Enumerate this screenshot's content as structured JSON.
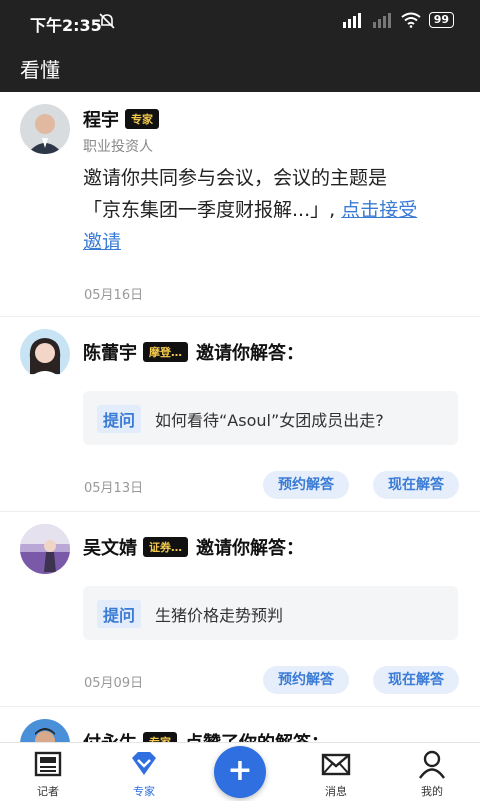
{
  "status_bar": {
    "time": "下午2:35",
    "battery": "99"
  },
  "header": {
    "title": "看懂"
  },
  "feed": [
    {
      "name": "程宇",
      "badge": "专家",
      "role": "职业投资人",
      "msg_prefix": "邀请你共同参与会议，会议的主题是「京东集团一季度财报解...」, ",
      "msg_link": "点击接受邀请",
      "date": "05月16日"
    },
    {
      "name": "陈蕾宇",
      "badge": "摩登…",
      "action": "邀请你解答：",
      "q_tag": "提问",
      "question": "如何看待“Asoul”女团成员出走?",
      "date": "05月13日",
      "btn_schedule": "预约解答",
      "btn_now": "现在解答"
    },
    {
      "name": "吴文婧",
      "badge": "证券…",
      "action": "邀请你解答：",
      "q_tag": "提问",
      "question": "生猪价格走势预判",
      "date": "05月09日",
      "btn_schedule": "预约解答",
      "btn_now": "现在解答"
    },
    {
      "name": "付永生",
      "badge": "专家",
      "action": "点赞了你的解答："
    }
  ],
  "tabbar": {
    "tabs": [
      {
        "label": "记者",
        "icon": "newspaper-icon"
      },
      {
        "label": "专家",
        "icon": "diamond-icon"
      },
      {
        "label": "",
        "icon": "plus-icon"
      },
      {
        "label": "消息",
        "icon": "mail-icon"
      },
      {
        "label": "我的",
        "icon": "person-icon"
      }
    ]
  },
  "colors": {
    "accent": "#2f6fe0",
    "link": "#3a7bd5",
    "dark_bar": "#222222"
  }
}
